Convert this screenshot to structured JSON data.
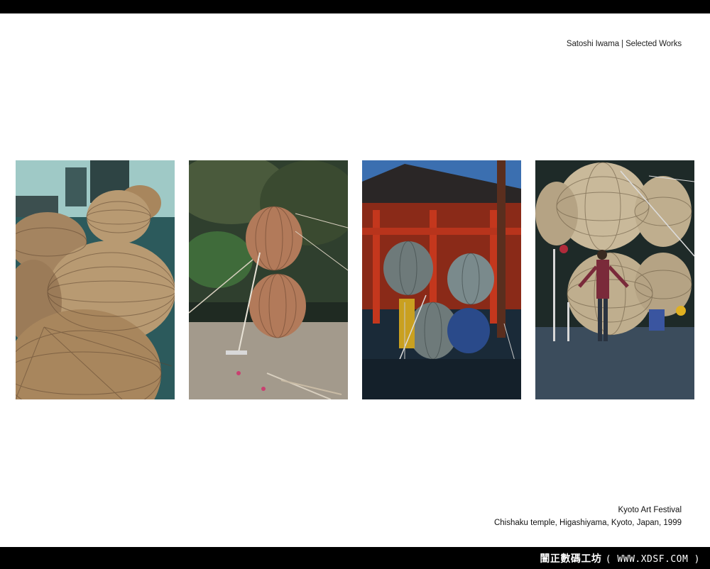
{
  "header": {
    "title": "Satoshi Iwama | Selected Works"
  },
  "photos": [
    {
      "name": "workshop-bamboo-spheres",
      "palette": {
        "sky": "#9fc9c6",
        "ground": "#2c5a5c",
        "bamboo": "#b89a72"
      }
    },
    {
      "name": "figure-eight-sculpture-forest",
      "palette": {
        "sky": "#2f3f2e",
        "ground": "#a39a8c",
        "bamboo": "#b27a5a"
      }
    },
    {
      "name": "temple-gate-spheres",
      "palette": {
        "sky": "#3b6fb0",
        "ground": "#1a2a38",
        "bamboo": "#7a8a8c",
        "temple": "#c4371d"
      }
    },
    {
      "name": "spheres-with-artist",
      "palette": {
        "sky": "#1e2a28",
        "ground": "#3b4c5c",
        "bamboo": "#c9b99a"
      }
    }
  ],
  "caption": {
    "line1": "Kyoto Art Festival",
    "line2": "Chishaku temple, Higashiyama, Kyoto, Japan, 1999"
  },
  "watermark": {
    "brand": "闓正數碼工坊",
    "url": "( WWW.XDSF.COM )"
  }
}
